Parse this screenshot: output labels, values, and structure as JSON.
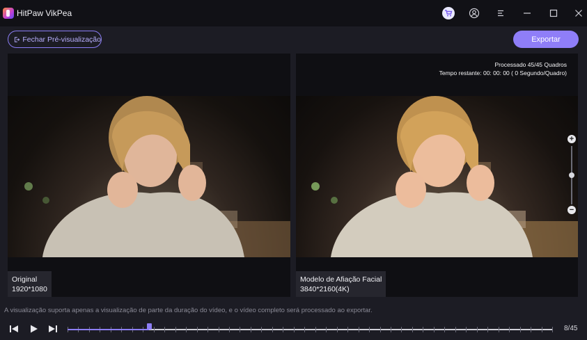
{
  "app": {
    "title": "HitPaw VikPea"
  },
  "toolbar": {
    "close_preview_label": "Fechar Pré-visualização",
    "export_label": "Exportar"
  },
  "left_panel": {
    "label": "Original",
    "resolution": "1920*1080"
  },
  "right_panel": {
    "label": "Modelo de Afiação Facial",
    "resolution": "3840*2160(4K)",
    "processed": "Processado 45/45 Quadros",
    "remaining": "Tempo restante: 00: 00: 00 ( 0 Segundo/Quadro)"
  },
  "zoom": {
    "level": 0.5
  },
  "notice": "A visualização suporta apenas a visualização de parte da duração do vídeo, e o vídeo completo será processado ao exportar.",
  "playback": {
    "frame_counter": "8/45",
    "current_frame": 8,
    "total_frames": 45
  },
  "colors": {
    "accent": "#8f7ef8",
    "background": "#1c1c24",
    "titlebar": "#111116"
  },
  "icons": [
    "app-logo-icon",
    "cart-icon",
    "user-icon",
    "menu-icon",
    "minimize-icon",
    "maximize-icon",
    "close-icon",
    "exit-icon",
    "zoom-in-icon",
    "zoom-out-icon",
    "previous-frame-icon",
    "play-icon",
    "next-frame-icon"
  ]
}
